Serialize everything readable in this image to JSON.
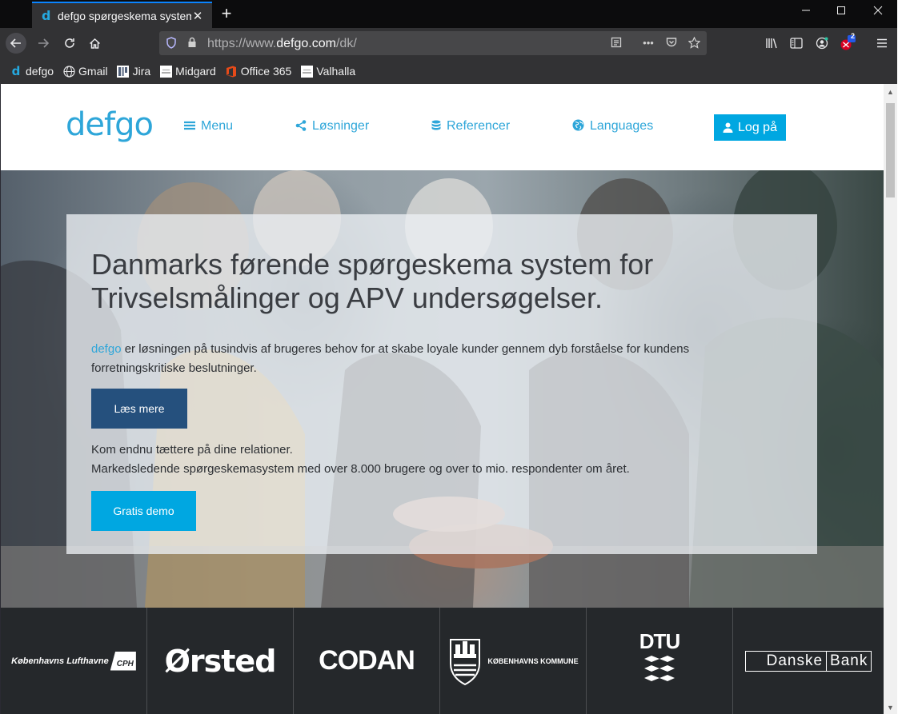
{
  "browser": {
    "tab_title": "defgo spørgeskema system",
    "tab_favicon": "d",
    "url_prefix": "https://www.",
    "url_host": "defgo.com",
    "url_path": "/dk/",
    "notification_badge": "2",
    "bookmarks": [
      {
        "label": "defgo",
        "icon": "defgo-icon"
      },
      {
        "label": "Gmail",
        "icon": "globe-icon"
      },
      {
        "label": "Jira",
        "icon": "jira-icon"
      },
      {
        "label": "Midgard",
        "icon": "sync-icon"
      },
      {
        "label": "Office 365",
        "icon": "office-icon"
      },
      {
        "label": "Valhalla",
        "icon": "sync-icon"
      }
    ]
  },
  "site": {
    "logo": "defgo",
    "menu": [
      {
        "label": "Menu",
        "icon": "hamburger-icon"
      },
      {
        "label": "Løsninger",
        "icon": "share-icon"
      },
      {
        "label": "Referencer",
        "icon": "database-icon"
      },
      {
        "label": "Languages",
        "icon": "globe-icon"
      }
    ],
    "login_label": "Log på"
  },
  "hero": {
    "title": "Danmarks førende spørgeskema system for Trivselsmålinger og APV undersøgelser.",
    "brand_word": "defgo",
    "description": " er løsningen på tusindvis af brugeres behov for at skabe loyale kunder gennem dyb forståelse for kundens forretningskritiske beslutninger.",
    "read_more_label": "Læs mere",
    "sub_line1": "Kom endnu tættere på dine relationer.",
    "sub_line2": "Markedsledende spørgeskemasystem med over 8.000 brugere og over to mio. respondenter om året.",
    "demo_label": "Gratis demo"
  },
  "clients": [
    {
      "name": "Københavns Lufthavne",
      "mark": "CPH"
    },
    {
      "name": "Ørsted"
    },
    {
      "name": "CODAN"
    },
    {
      "name": "KØBENHAVNS KOMMUNE"
    },
    {
      "name": "DTU"
    },
    {
      "name": "Danske",
      "name2": "Bank"
    }
  ],
  "colors": {
    "brand_blue": "#2ea6d9",
    "cta_blue": "#00a7e1",
    "dark_button": "#25507d"
  }
}
